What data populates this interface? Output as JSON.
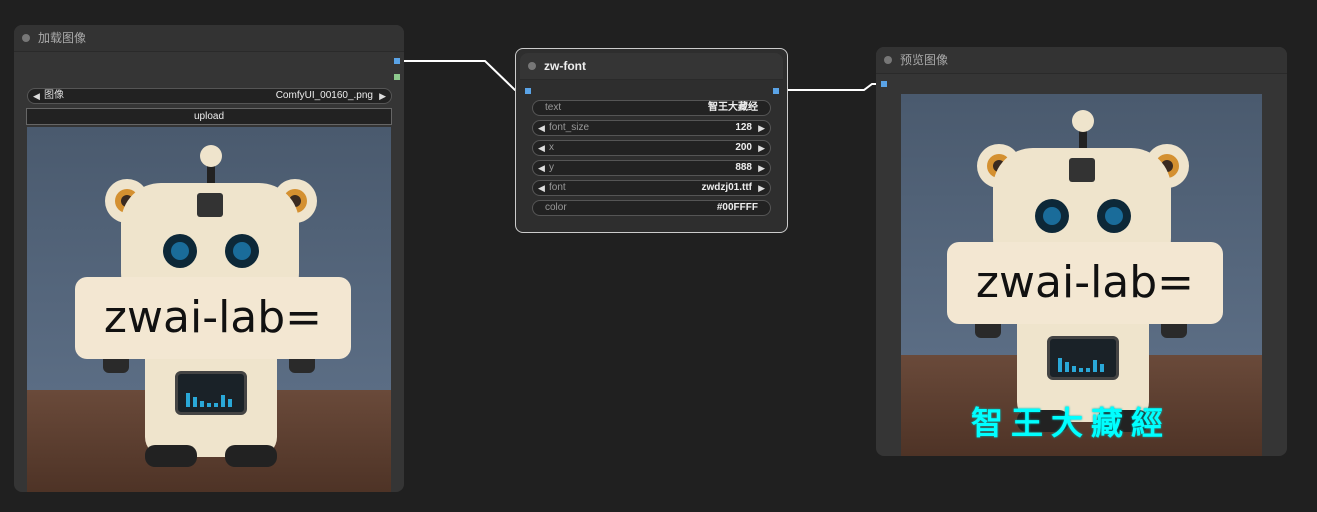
{
  "load_node": {
    "title": "加载图像",
    "image_widget": {
      "label": "图像",
      "value": "ComfyUI_00160_.png"
    },
    "upload_label": "upload"
  },
  "zw_node": {
    "title": "zw-font",
    "widgets": [
      {
        "label": "text",
        "value": "智王大藏经",
        "arrows": false
      },
      {
        "label": "font_size",
        "value": "128",
        "arrows": true
      },
      {
        "label": "x",
        "value": "200",
        "arrows": true
      },
      {
        "label": "y",
        "value": "888",
        "arrows": true
      },
      {
        "label": "font",
        "value": "zwdzj01.ttf",
        "arrows": true
      },
      {
        "label": "color",
        "value": "#00FFFF",
        "arrows": false
      }
    ]
  },
  "preview_node": {
    "title": "预览图像"
  },
  "image": {
    "sign_text": "zwai-lab=",
    "overlay_text": "智王大藏經"
  },
  "colors": {
    "canvas_bg": "#202020",
    "node_bg": "#353535",
    "link": "#ffffff",
    "port_image": "#5aa3e6",
    "port_mask": "#8dc98d",
    "overlay_text": "#00ffff"
  }
}
